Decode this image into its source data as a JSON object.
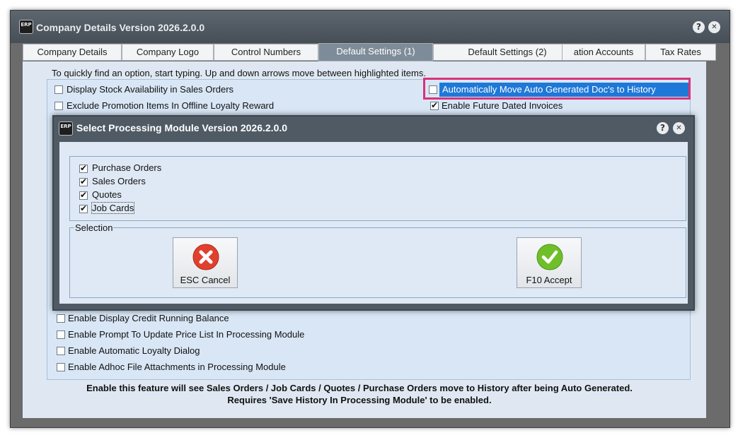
{
  "window": {
    "title": "Company Details Version 2026.2.0.0",
    "help_glyph": "?",
    "close_glyph": "✕",
    "icon_text": "ERP"
  },
  "tabs": [
    {
      "label": "Company Details"
    },
    {
      "label": "Company Logo"
    },
    {
      "label": "Control Numbers"
    },
    {
      "label": "Default Settings (1)"
    },
    {
      "label": "Default Settings (2)"
    },
    {
      "label": "ation Accounts"
    },
    {
      "label": "Tax Rates"
    }
  ],
  "hint": "To quickly find an option, start typing. Up and down arrows move between highlighted items.",
  "options_left_top": [
    {
      "label": "Display Stock Availability in Sales Orders",
      "checked": false
    },
    {
      "label": "Exclude Promotion Items In Offline Loyalty Reward",
      "checked": false
    }
  ],
  "options_right_top": [
    {
      "label": "Automatically Move Auto Generated Doc's to History",
      "checked": false
    },
    {
      "label": "Enable Future Dated Invoices",
      "checked": true
    }
  ],
  "options_bottom": [
    {
      "label": "Enable Display Credit Running Balance",
      "checked": false
    },
    {
      "label": "Enable Prompt To Update Price List In Processing Module",
      "checked": false
    },
    {
      "label": "Enable Automatic Loyalty Dialog",
      "checked": false
    },
    {
      "label": "Enable Adhoc File Attachments in Processing Module",
      "checked": false
    }
  ],
  "dialog": {
    "title": "Select Processing Module Version 2026.2.0.0",
    "modules": [
      {
        "label": "Purchase Orders",
        "checked": true
      },
      {
        "label": "Sales Orders",
        "checked": true
      },
      {
        "label": "Quotes",
        "checked": true
      },
      {
        "label": "Job Cards",
        "checked": true
      }
    ],
    "selection_legend": "Selection",
    "cancel_label": "ESC Cancel",
    "accept_label": "F10 Accept"
  },
  "footer": {
    "line1": "Enable this feature will see Sales Orders / Job Cards / Quotes / Purchase Orders move to History after being Auto Generated.",
    "line2": "Requires 'Save History In Processing Module' to be enabled."
  },
  "colors": {
    "highlight_border": "#d8337a",
    "selection_blue": "#1e78d7",
    "cancel_red": "#e0402e",
    "accept_green": "#6fbf2a"
  }
}
